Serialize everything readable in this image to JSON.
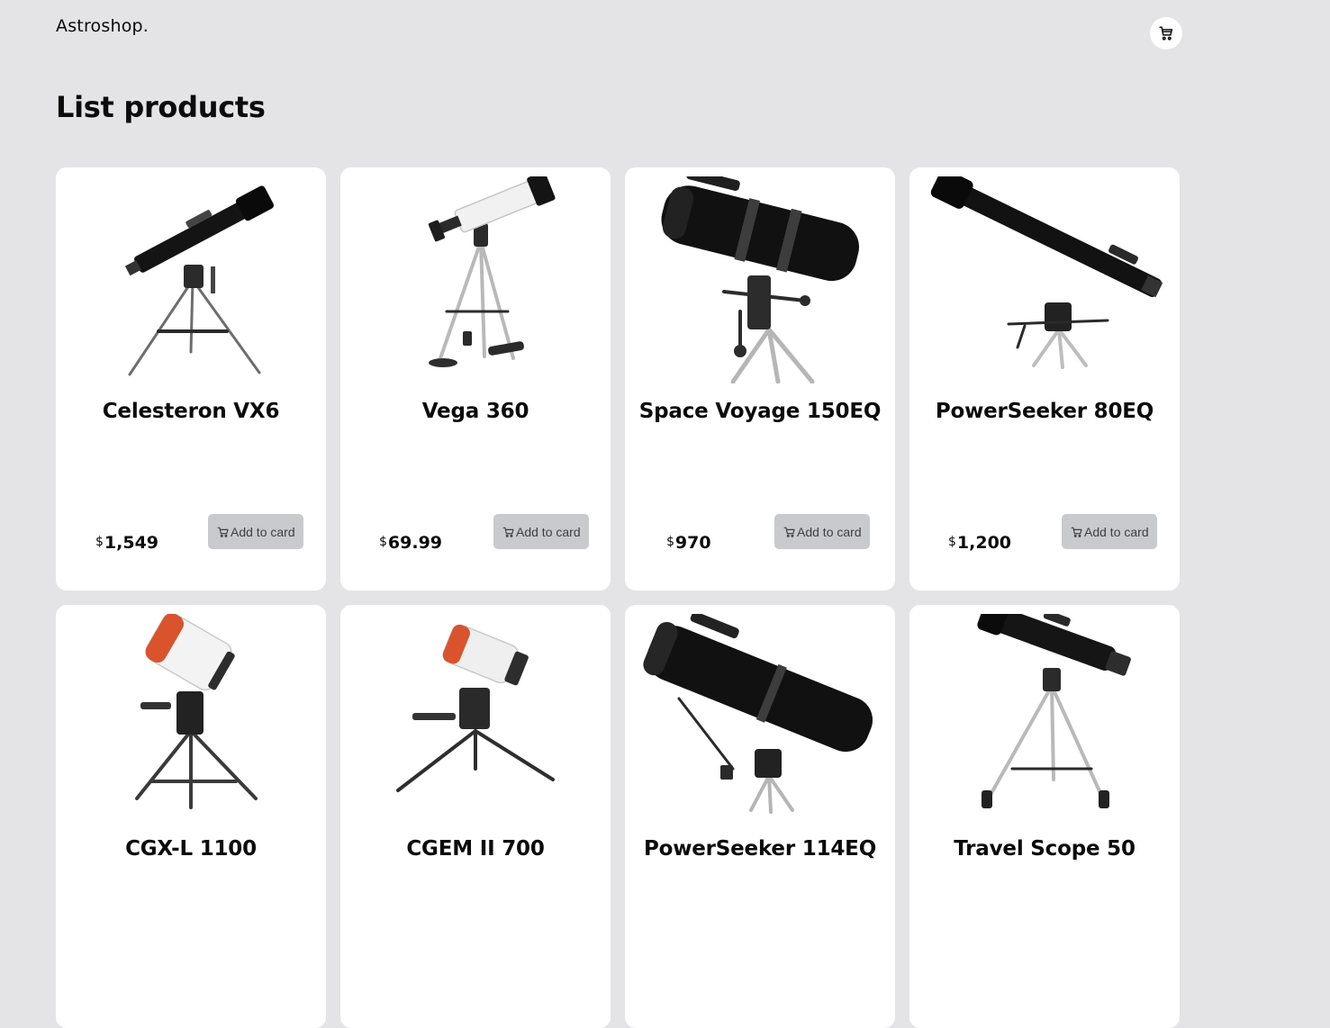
{
  "header": {
    "brand": "Astroshop.",
    "cart_icon": "cart-icon"
  },
  "main": {
    "title": "List products"
  },
  "products": [
    {
      "name": "Celesteron VX6",
      "currency": "$",
      "price": "1,549",
      "button_label": "Add to card",
      "image_icon": "refractor-telescope-image"
    },
    {
      "name": "Vega 360",
      "currency": "$",
      "price": "69.99",
      "button_label": "Add to card",
      "image_icon": "white-refractor-telescope-image"
    },
    {
      "name": "Space Voyage 150EQ",
      "currency": "$",
      "price": "970",
      "button_label": "Add to card",
      "image_icon": "reflector-telescope-image"
    },
    {
      "name": "PowerSeeker 80EQ",
      "currency": "$",
      "price": "1,200",
      "button_label": "Add to card",
      "image_icon": "long-refractor-telescope-image"
    },
    {
      "name": "CGX-L 1100",
      "image_icon": "schmidt-cassegrain-telescope-image"
    },
    {
      "name": "CGEM II 700",
      "image_icon": "compact-cassegrain-telescope-image"
    },
    {
      "name": "PowerSeeker 114EQ",
      "image_icon": "large-reflector-telescope-image"
    },
    {
      "name": "Travel Scope 50",
      "image_icon": "travel-telescope-image"
    }
  ]
}
